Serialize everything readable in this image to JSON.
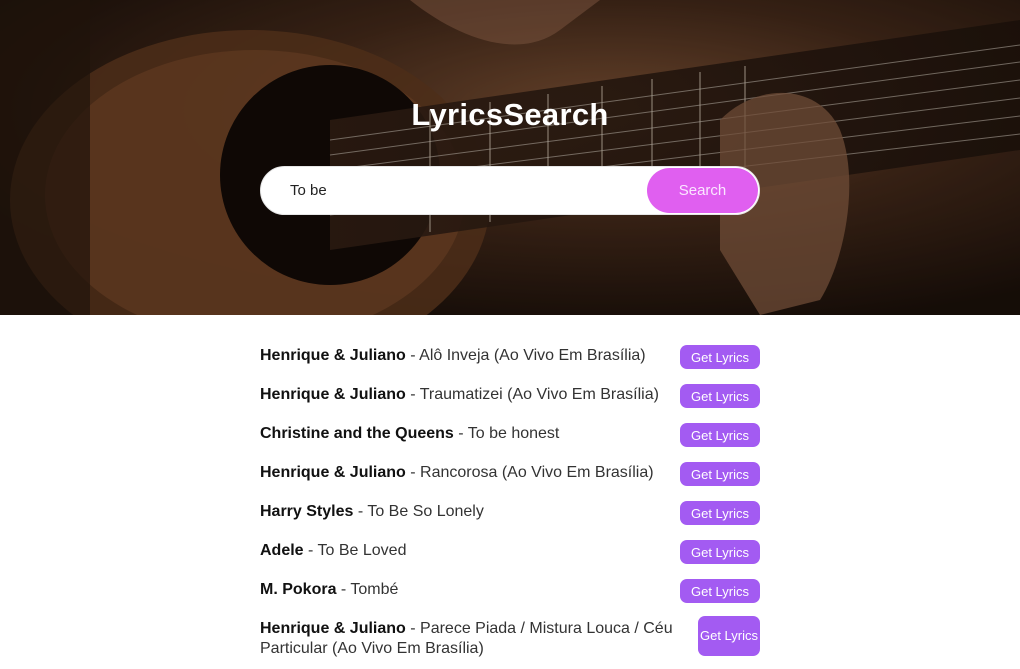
{
  "app": {
    "title": "LyricsSearch"
  },
  "search": {
    "value": "To be",
    "placeholder": "",
    "button_label": "Search"
  },
  "colors": {
    "search_button": "#e05ff0",
    "lyrics_button": "#a35bf2",
    "hero_overlay": "#2a1a10"
  },
  "results": [
    {
      "artist": "Henrique & Juliano",
      "separator": " - ",
      "title": "Alô Inveja (Ao Vivo Em Brasília)",
      "button_label": "Get Lyrics"
    },
    {
      "artist": "Henrique & Juliano",
      "separator": " - ",
      "title": "Traumatizei (Ao Vivo Em Brasília)",
      "button_label": "Get Lyrics"
    },
    {
      "artist": "Christine and the Queens",
      "separator": " - ",
      "title": "To be honest",
      "button_label": "Get Lyrics"
    },
    {
      "artist": "Henrique & Juliano",
      "separator": " - ",
      "title": "Rancorosa (Ao Vivo Em Brasília)",
      "button_label": "Get Lyrics"
    },
    {
      "artist": "Harry Styles",
      "separator": " - ",
      "title": "To Be So Lonely",
      "button_label": "Get Lyrics"
    },
    {
      "artist": "Adele",
      "separator": " - ",
      "title": "To Be Loved",
      "button_label": "Get Lyrics"
    },
    {
      "artist": "M. Pokora",
      "separator": " - ",
      "title": "Tombé",
      "button_label": "Get Lyrics"
    },
    {
      "artist": "Henrique & Juliano",
      "separator": " - ",
      "title": "Parece Piada / Mistura Louca / Céu Particular (Ao Vivo Em Brasília)",
      "button_label": "Get Lyrics"
    }
  ]
}
